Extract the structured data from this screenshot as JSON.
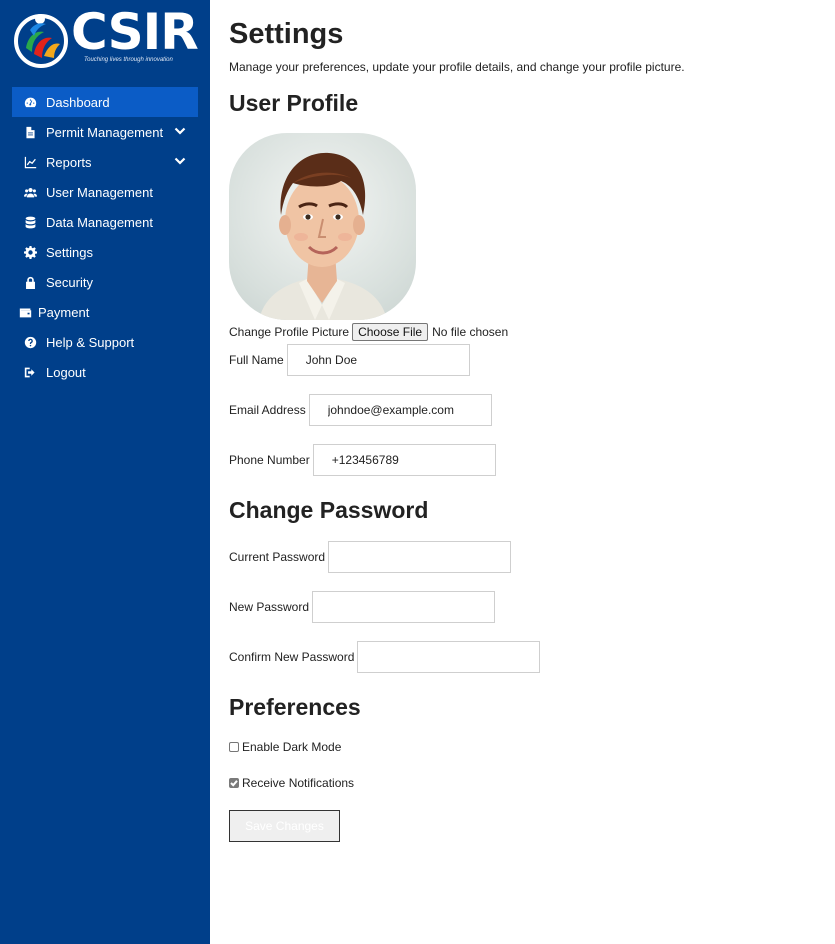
{
  "brand": {
    "name": "CSIR",
    "tagline": "Touching lives through innovation"
  },
  "colors": {
    "sidebar_bg": "#003f8a",
    "active_bg": "#0b5cc6"
  },
  "sidebar": {
    "items": [
      {
        "label": "Dashboard",
        "icon": "dashboard-icon",
        "active": true,
        "expandable": false
      },
      {
        "label": "Permit Management",
        "icon": "document-icon",
        "active": false,
        "expandable": true
      },
      {
        "label": "Reports",
        "icon": "line-chart-icon",
        "active": false,
        "expandable": true
      },
      {
        "label": "User Management",
        "icon": "users-icon",
        "active": false,
        "expandable": false
      },
      {
        "label": "Data Management",
        "icon": "database-icon",
        "active": false,
        "expandable": false
      },
      {
        "label": "Settings",
        "icon": "gear-icon",
        "active": false,
        "expandable": false
      },
      {
        "label": "Security",
        "icon": "lock-icon",
        "active": false,
        "expandable": false
      },
      {
        "label": "Payment",
        "icon": "wallet-icon",
        "active": false,
        "expandable": false
      },
      {
        "label": "Help & Support",
        "icon": "question-icon",
        "active": false,
        "expandable": false
      },
      {
        "label": "Logout",
        "icon": "logout-icon",
        "active": false,
        "expandable": false
      }
    ]
  },
  "page": {
    "title": "Settings",
    "subtitle": "Manage your preferences, update your profile details, and change your profile picture."
  },
  "profile": {
    "heading": "User Profile",
    "change_picture_label": "Change Profile Picture",
    "choose_file_label": "Choose File",
    "file_status": "No file chosen",
    "full_name_label": "Full Name",
    "full_name_value": "John Doe",
    "email_label": "Email Address",
    "email_value": "johndoe@example.com",
    "phone_label": "Phone Number",
    "phone_value": "+123456789"
  },
  "password": {
    "heading": "Change Password",
    "current_label": "Current Password",
    "new_label": "New Password",
    "confirm_label": "Confirm New Password"
  },
  "preferences": {
    "heading": "Preferences",
    "dark_mode_label": "Enable Dark Mode",
    "dark_mode_checked": false,
    "notifications_label": "Receive Notifications",
    "notifications_checked": true
  },
  "save_label": "Save Changes"
}
